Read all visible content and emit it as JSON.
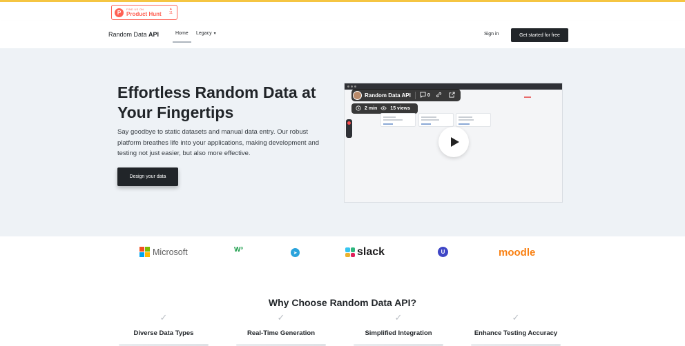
{
  "producthunt": {
    "find_us": "FIND US ON",
    "name": "Product Hunt",
    "arrow": "▲",
    "votes": "11"
  },
  "nav": {
    "brand_part1": "Random Data ",
    "brand_part2": "API",
    "home": "Home",
    "legacy": "Legacy",
    "caret": "▾",
    "signin": "Sign in",
    "get_started": "Get started for free"
  },
  "hero": {
    "title": "Effortless Random Data at Your Fingertips",
    "description": "Say goodbye to static datasets and manual data entry. Our robust platform breathes life into your applications, making development and testing not just easier, but also more effective.",
    "cta": "Design your data"
  },
  "video": {
    "title": "Random Data API",
    "comments": "0",
    "duration": "2 min",
    "views": "15 views"
  },
  "logos": [
    "Microsoft",
    "w3schools",
    "telegram",
    "slack",
    "udemy",
    "moodle"
  ],
  "why": {
    "title_part1": "Why Choose Random Data ",
    "title_part2": "API",
    "title_part3": "?"
  },
  "features": [
    {
      "title": "Diverse Data Types"
    },
    {
      "title": "Real-Time Generation"
    },
    {
      "title": "Simplified Integration"
    },
    {
      "title": "Enhance Testing Accuracy"
    }
  ],
  "colors": {
    "accent_strip": "#f5c542",
    "producthunt": "#ff6154",
    "dark_button": "#212529",
    "hero_bg": "#eef2f6"
  }
}
